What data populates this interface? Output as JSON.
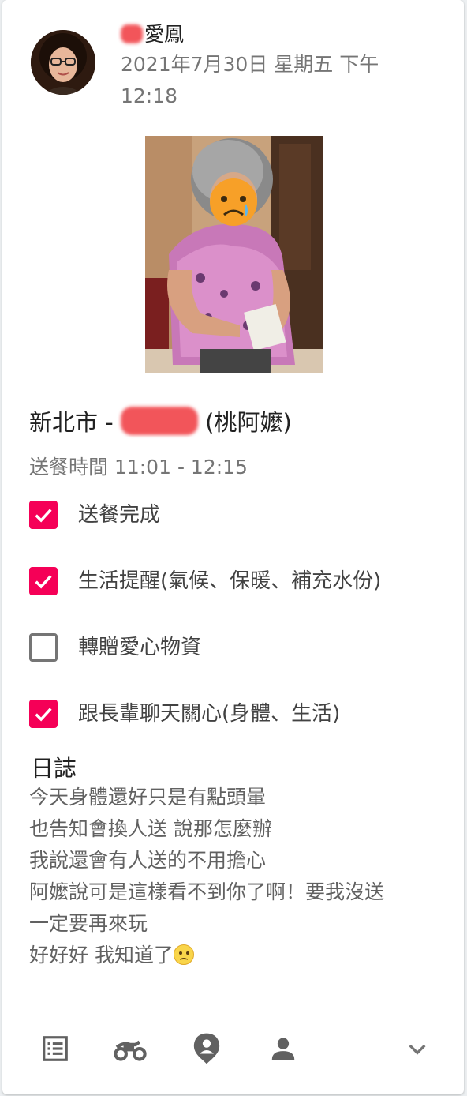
{
  "post": {
    "author_visible": "愛鳳",
    "timestamp": "2021年7月30日 星期五 下午 12:18"
  },
  "delivery": {
    "location_prefix": "新北市 -",
    "location_suffix": "(桃阿嬤)",
    "time": "送餐時間 11:01 - 12:15"
  },
  "tasks": [
    {
      "label": "送餐完成",
      "checked": true
    },
    {
      "label": "生活提醒(氣候、保暖、補充水份)",
      "checked": true
    },
    {
      "label": "轉贈愛心物資",
      "checked": false
    },
    {
      "label": "跟長輩聊天關心(身體、生活)",
      "checked": true
    }
  ],
  "log": {
    "title": "日誌",
    "lines": [
      "今天身體還好只是有點頭暈",
      "也告知會換人送 說那怎麼辦",
      "我說還會有人送的不用擔心",
      "阿嬤說可是這樣看不到你了啊！要我沒送",
      "一定要再來玩",
      "好好好 我知道了"
    ],
    "last_line_emoji": "crying-face-emoji"
  },
  "toolbar": {
    "icons": [
      "list-icon",
      "scooter-icon",
      "location-person-icon",
      "person-icon",
      "chevron-down-icon"
    ]
  },
  "colors": {
    "accent": "#f50057",
    "redaction": "#f2555a",
    "secondary_text": "#757575"
  }
}
